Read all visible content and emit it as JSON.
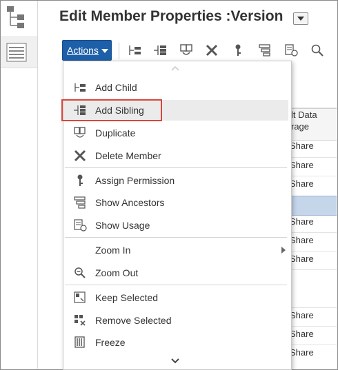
{
  "header": {
    "title": "Edit Member Properties :Version"
  },
  "toolbar": {
    "actions_label": "Actions"
  },
  "grid": {
    "column_header_line1": "lt Data",
    "column_header_line2": "rage",
    "cells": [
      "Share",
      "Share",
      "Share",
      "Share",
      "Share",
      "Share",
      "Share",
      "Share",
      "Share"
    ]
  },
  "menu": {
    "items": [
      {
        "label": "Add Child",
        "icon": "add-child-icon"
      },
      {
        "label": "Add Sibling",
        "icon": "add-sibling-icon"
      },
      {
        "label": "Duplicate",
        "icon": "duplicate-icon"
      },
      {
        "label": "Delete Member",
        "icon": "delete-x-icon"
      },
      {
        "label": "Assign Permission",
        "icon": "key-icon"
      },
      {
        "label": "Show Ancestors",
        "icon": "ancestors-icon"
      },
      {
        "label": "Show Usage",
        "icon": "usage-icon"
      },
      {
        "label": "Zoom In",
        "icon": ""
      },
      {
        "label": "Zoom Out",
        "icon": "zoom-out-icon"
      },
      {
        "label": "Keep Selected",
        "icon": "keep-selected-icon"
      },
      {
        "label": "Remove Selected",
        "icon": "remove-selected-icon"
      },
      {
        "label": "Freeze",
        "icon": "freeze-icon"
      }
    ]
  },
  "colors": {
    "accent": "#1d5fa8",
    "highlight_border": "#d9463a",
    "selection": "#c5d5ea"
  }
}
